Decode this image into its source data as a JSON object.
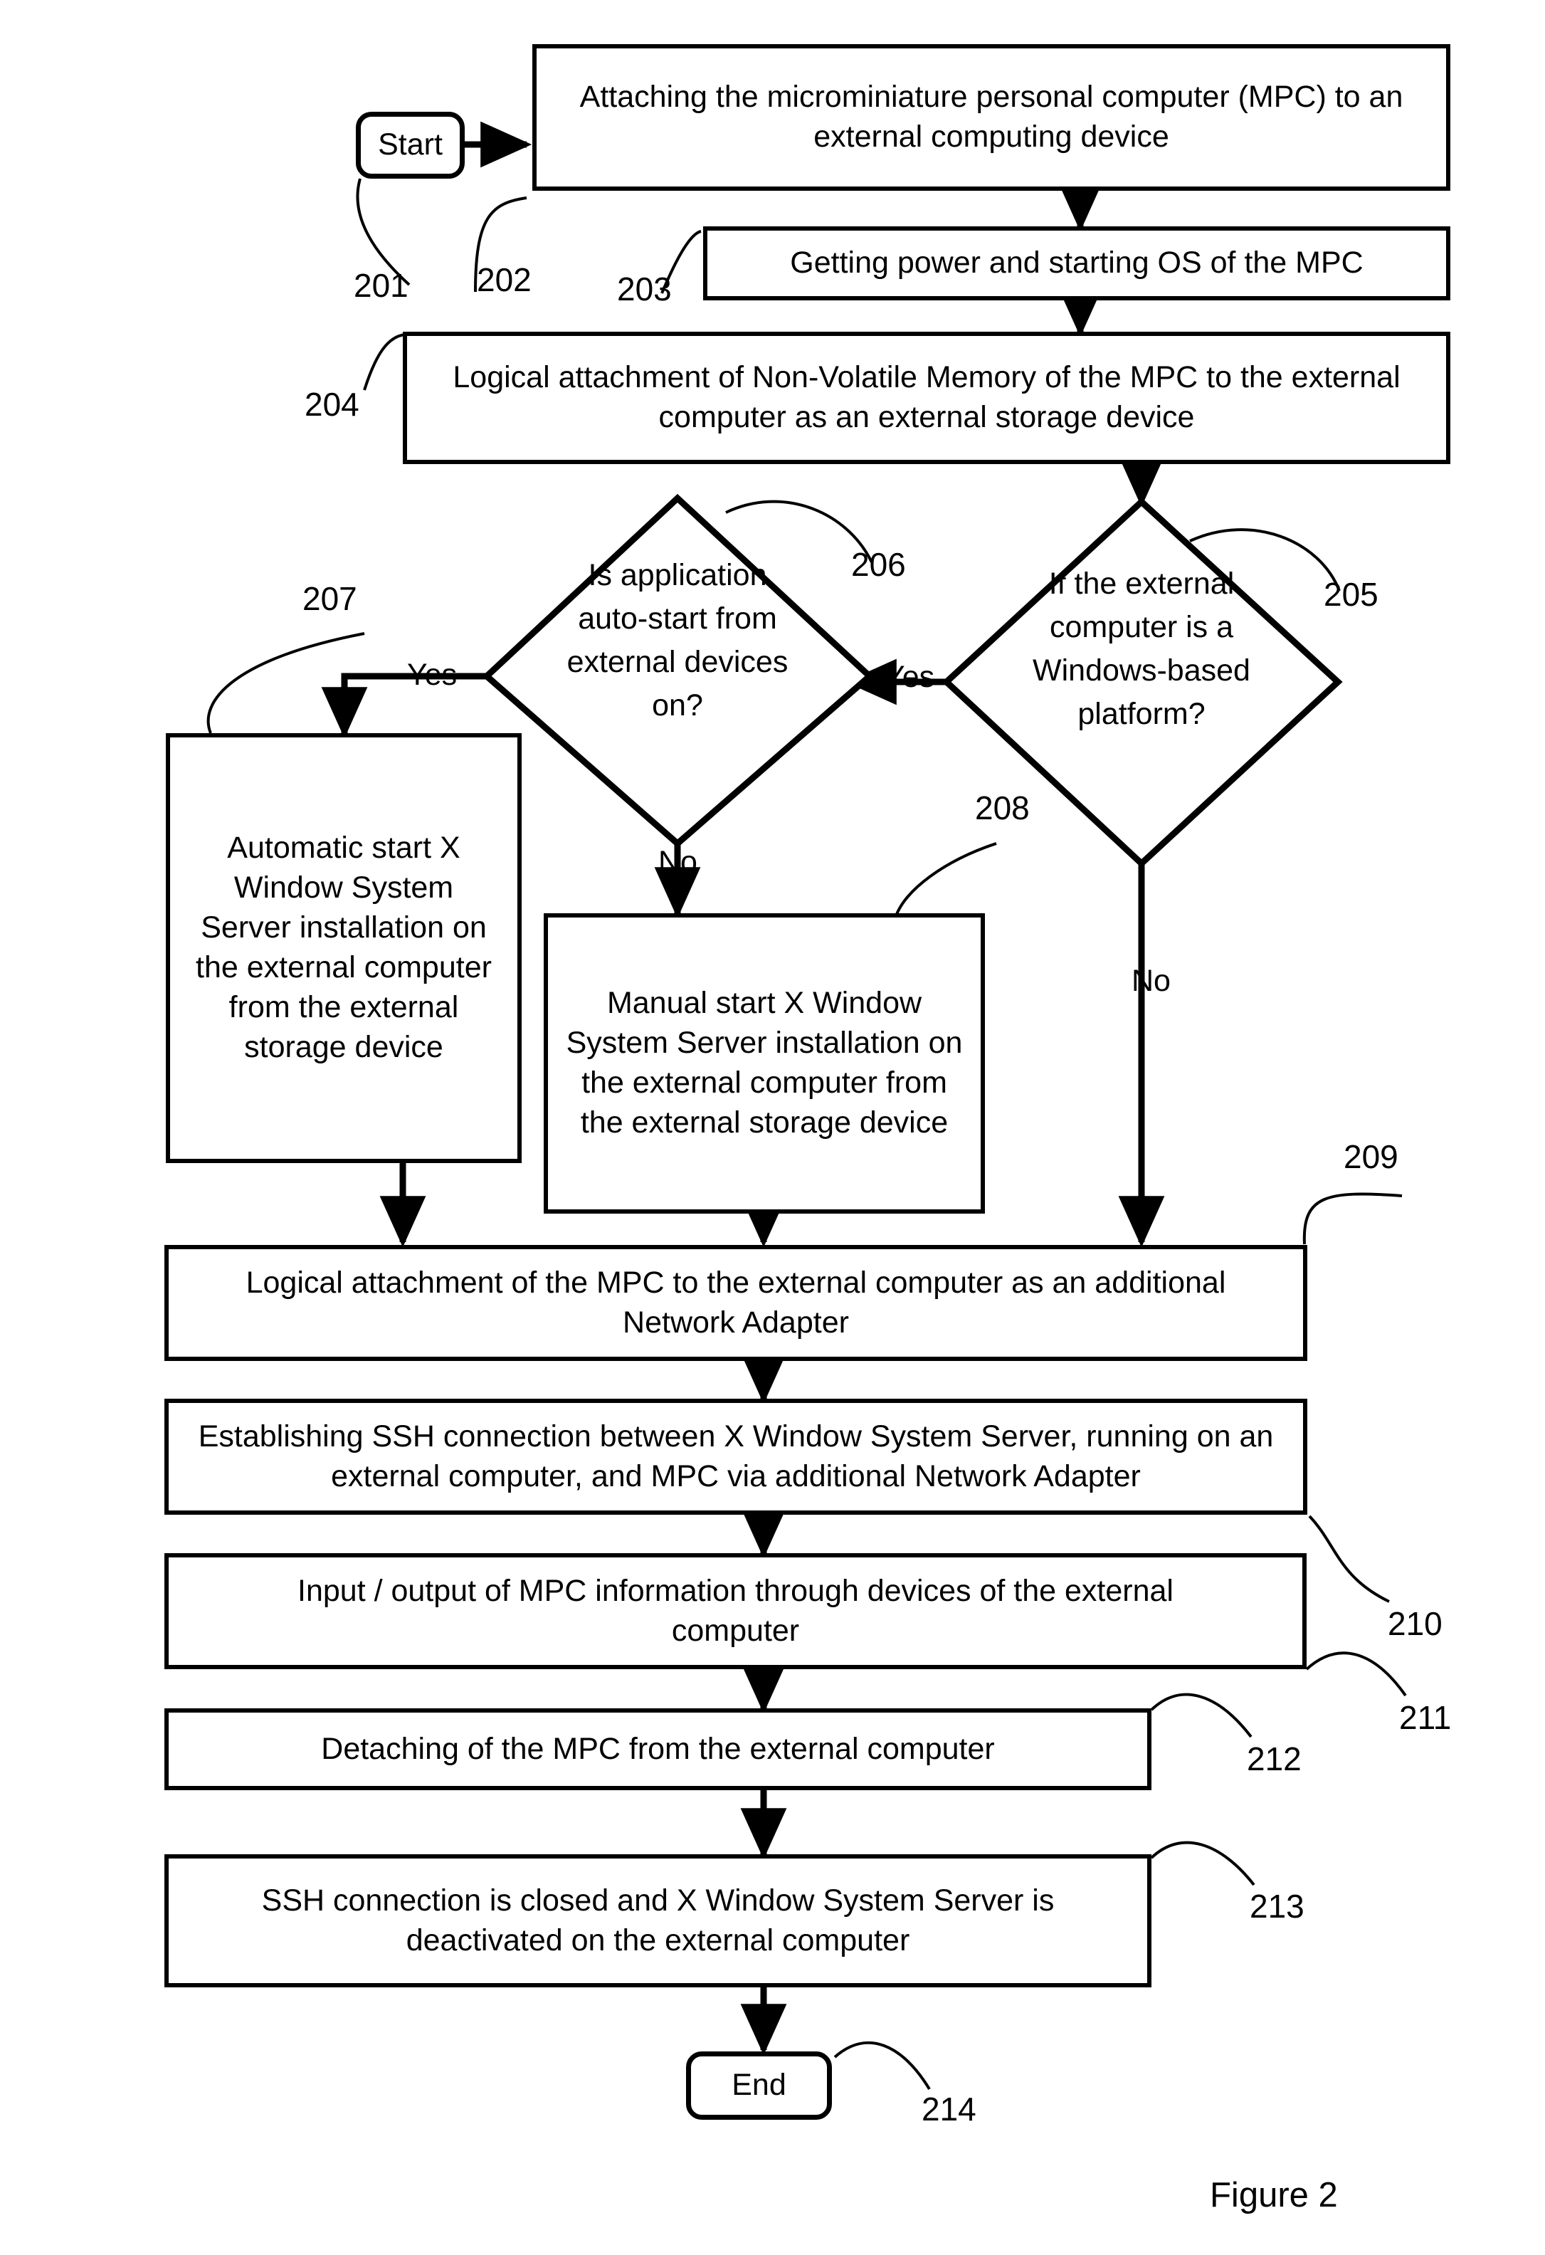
{
  "figure": {
    "caption": "Figure 2"
  },
  "nodes": {
    "start": {
      "label": "Start",
      "ref": "201"
    },
    "attach_mpc": {
      "label": "Attaching the microminiature personal computer (MPC) to an external computing device",
      "ref": "202"
    },
    "power_os": {
      "label": "Getting power and starting OS of the MPC",
      "ref": "203"
    },
    "logical_nvm": {
      "label": "Logical attachment of Non-Volatile Memory of the MPC to the external computer as an external storage device",
      "ref": "204"
    },
    "decision_windows": {
      "label": "If the external computer is a Windows-based platform?",
      "ref": "205"
    },
    "decision_autostart": {
      "label": "Is application auto-start from external devices on?",
      "ref": "206"
    },
    "automatic_start": {
      "label": "Automatic start X Window System Server installation on the external computer from the external storage device",
      "ref": "207"
    },
    "manual_start": {
      "label": "Manual start X Window System Server installation on the external computer from the external storage device",
      "ref": "208"
    },
    "logical_netadapter": {
      "label": "Logical attachment of the MPC to the external computer as an additional Network Adapter",
      "ref": "209"
    },
    "ssh_establish": {
      "label": "Establishing SSH connection between X Window System Server, running on an external computer, and MPC via additional Network Adapter",
      "ref": "210"
    },
    "io_mpc": {
      "label": "Input / output of MPC information through devices of the external computer",
      "ref": "211"
    },
    "detach_mpc": {
      "label": "Detaching of the MPC from the external computer",
      "ref": "212"
    },
    "ssh_close": {
      "label": "SSH connection is closed and X Window System Server is deactivated on the external computer",
      "ref": "213"
    },
    "end": {
      "label": "End",
      "ref": "214"
    }
  },
  "edge_labels": {
    "windows_yes": "Yes",
    "windows_no": "No",
    "autostart_yes": "Yes",
    "autostart_no": "No"
  },
  "colors": {
    "stroke": "#000000",
    "background": "#ffffff"
  }
}
